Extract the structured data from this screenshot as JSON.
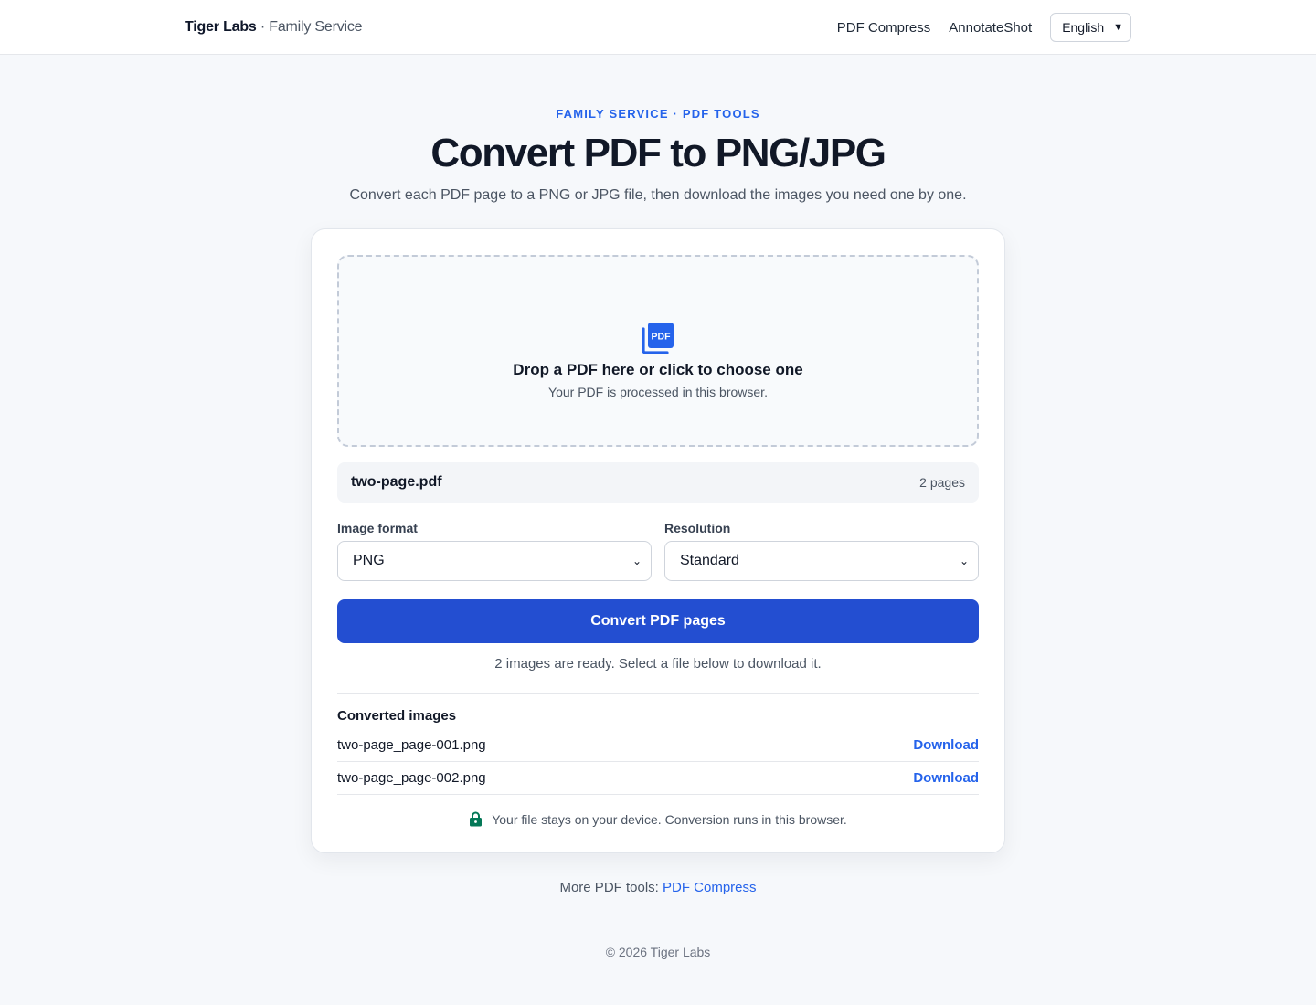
{
  "header": {
    "brand_name": "Tiger Labs",
    "brand_sep": " · ",
    "brand_sub": "Family Service",
    "nav": [
      "PDF Compress",
      "AnnotateShot"
    ],
    "language": "English"
  },
  "hero": {
    "eyebrow": "FAMILY SERVICE · PDF TOOLS",
    "title": "Convert PDF to PNG/JPG",
    "subtitle": "Convert each PDF page to a PNG or JPG file, then download the images you need one by one."
  },
  "dropzone": {
    "icon": "pdf-file-icon",
    "title": "Drop a PDF here or click to choose one",
    "note": "Your PDF is processed in this browser."
  },
  "file": {
    "name": "two-page.pdf",
    "pages": "2 pages"
  },
  "options": {
    "format_label": "Image format",
    "format_value": "PNG",
    "resolution_label": "Resolution",
    "resolution_value": "Standard"
  },
  "convert_button": "Convert PDF pages",
  "status": "2 images are ready. Select a file below to download it.",
  "results": {
    "title": "Converted images",
    "items": [
      {
        "name": "two-page_page-001.png",
        "action": "Download"
      },
      {
        "name": "two-page_page-002.png",
        "action": "Download"
      }
    ]
  },
  "privacy": {
    "icon": "lock-icon",
    "text": "Your file stays on your device. Conversion runs in this browser."
  },
  "more": {
    "prefix": "More PDF tools: ",
    "link": "PDF Compress"
  },
  "footer": "© 2026 Tiger Labs",
  "colors": {
    "accent": "#2563eb",
    "button": "#234ed1",
    "lock": "#047857"
  }
}
